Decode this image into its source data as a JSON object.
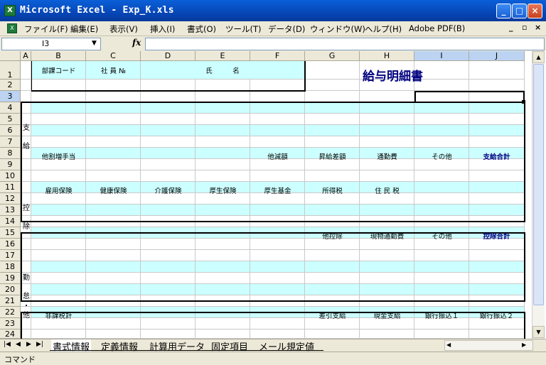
{
  "window": {
    "title": "Microsoft Excel - Exp_K.xls",
    "app_icon": "X"
  },
  "window_buttons": {
    "minimize": "_",
    "maximize": "□",
    "close": "×"
  },
  "menu": {
    "items": [
      "ファイル(F)",
      "編集(E)",
      "表示(V)",
      "挿入(I)",
      "書式(O)",
      "ツール(T)",
      "データ(D)",
      "ウィンドウ(W)",
      "ヘルプ(H)",
      "Adobe PDF(B)"
    ],
    "doc_controls": {
      "minimize": "_",
      "restore": "▫",
      "close": "×"
    }
  },
  "formula_bar": {
    "name_box": "I3",
    "fx": "fx",
    "formula": ""
  },
  "columns": [
    "A",
    "B",
    "C",
    "D",
    "E",
    "F",
    "G",
    "H",
    "I",
    "J"
  ],
  "rows": [
    "1",
    "2",
    "3",
    "4",
    "5",
    "6",
    "7",
    "8",
    "9",
    "10",
    "11",
    "12",
    "13",
    "14",
    "15",
    "16",
    "17",
    "18",
    "19",
    "20",
    "21",
    "22",
    "23",
    "24"
  ],
  "sheet": {
    "header": {
      "dept_code": "部課コード",
      "emp_no": "社 員 №",
      "name_label": "氏　　　名",
      "title": "給与明細書"
    },
    "pay": {
      "side_1": "支",
      "side_2": "給",
      "row8": {
        "b": "他割増手当",
        "f": "他減額",
        "g": "昇給差額",
        "h": "通勤費",
        "i": "その他",
        "j": "支給合計"
      }
    },
    "deduction": {
      "side_1": "控",
      "side_2": "除",
      "row11": {
        "b": "雇用保険",
        "c": "健康保険",
        "d": "介護保険",
        "e": "厚生保険",
        "f": "厚生基金",
        "g": "所得税",
        "h": "住 民 税"
      },
      "row15": {
        "g": "他控除",
        "h": "現物通勤費",
        "i": "その他",
        "j": "控除合計"
      }
    },
    "attendance": {
      "side_1": "勤",
      "side_2": "怠",
      "side_3": "・",
      "side_4": "他",
      "row22": {
        "b": "非課税計",
        "g": "差引支給",
        "h": "現金支給",
        "i": "銀行振込１",
        "j": "銀行振込２"
      }
    }
  },
  "tabs": {
    "nav": [
      "|◀",
      "◀",
      "▶",
      "▶|"
    ],
    "items": [
      "書式情報",
      "定義情報",
      "計算用データ",
      "固定項目",
      "メール規定値"
    ],
    "active": "書式情報"
  },
  "status": {
    "text": "コマンド"
  },
  "colors": {
    "cell_fill": "#ccffff",
    "title_color": "#000080",
    "titlebar": "#0a5fd8"
  }
}
